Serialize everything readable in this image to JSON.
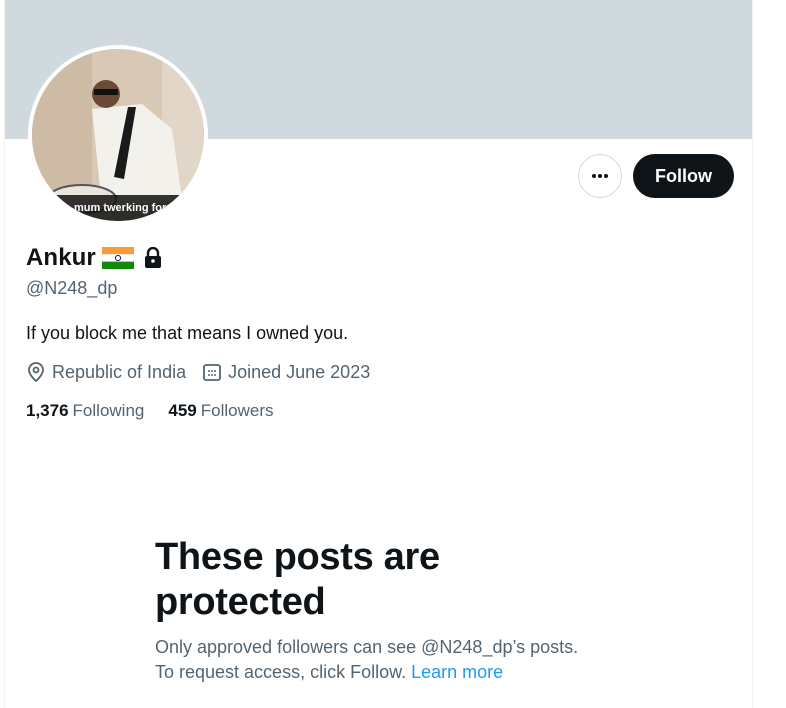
{
  "profile": {
    "name": "Ankur",
    "handle": "@N248_dp",
    "bio": "If you block me that means I owned you.",
    "location": "Republic of India",
    "joined": "Joined June 2023",
    "avatar_caption": "mum twerking for",
    "following_count": "1,376",
    "following_label": "Following",
    "followers_count": "459",
    "followers_label": "Followers"
  },
  "actions": {
    "follow_label": "Follow",
    "more_icon": "more-horizontal-icon"
  },
  "protected": {
    "title": "These posts are protected",
    "line1": "Only approved followers can see @N248_dp’s posts.",
    "line2_prefix": "To request access, click Follow. ",
    "learn_more": "Learn more"
  },
  "colors": {
    "banner": "#cfd9de",
    "follow_bg": "#0f1419",
    "link": "#1d9bf0",
    "secondary_text": "#536471"
  }
}
